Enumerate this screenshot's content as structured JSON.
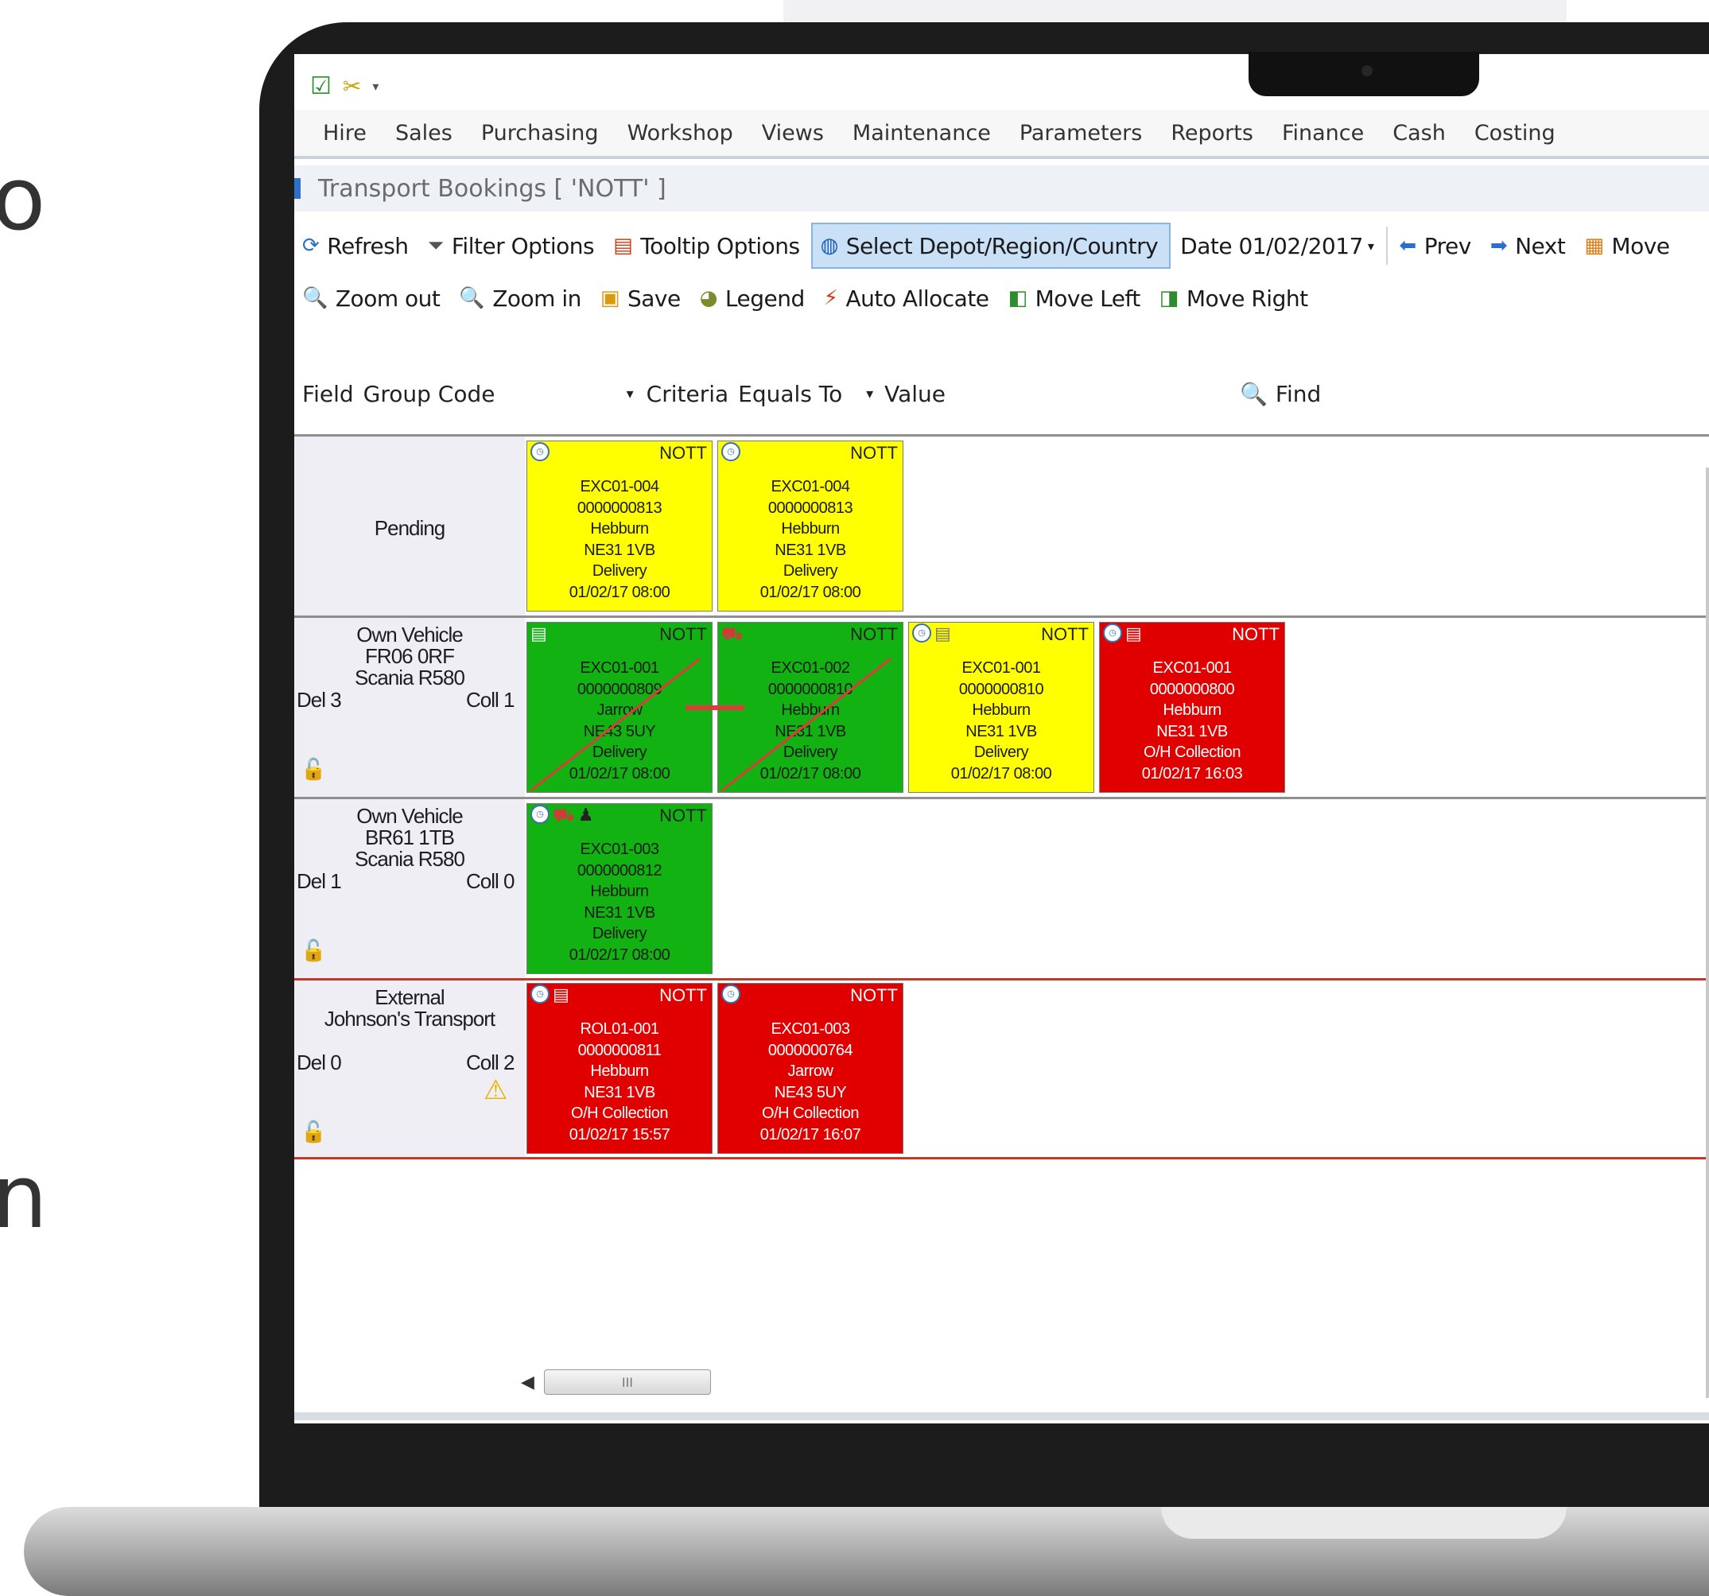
{
  "side_text": {
    "top": "o",
    "bottom": "n"
  },
  "app": {
    "qat_icons": [
      "save-check-icon",
      "tools-icon",
      "dropdown-caret-icon"
    ],
    "menu": [
      "Hire",
      "Sales",
      "Purchasing",
      "Workshop",
      "Views",
      "Maintenance",
      "Parameters",
      "Reports",
      "Finance",
      "Cash",
      "Costing"
    ],
    "window_title": "Transport Bookings [ 'NOTT' ]",
    "toolbar1": {
      "refresh": "Refresh",
      "filter": "Filter Options",
      "tooltip": "Tooltip Options",
      "select_depot": "Select Depot/Region/Country",
      "date": "Date 01/02/2017",
      "prev": "Prev",
      "next": "Next",
      "move": "Move"
    },
    "toolbar2": {
      "zoom_out": "Zoom out",
      "zoom_in": "Zoom in",
      "save": "Save",
      "legend": "Legend",
      "auto_allocate": "Auto Allocate",
      "move_left": "Move Left",
      "move_right": "Move Right"
    },
    "search": {
      "field_label": "Field",
      "field_value": "Group Code",
      "criteria_label": "Criteria",
      "criteria_value": "Equals To",
      "value_label": "Value",
      "value": "",
      "find": "Find"
    }
  },
  "rows": [
    {
      "label_lines": [
        "Pending"
      ],
      "cards": [
        {
          "depot": "NOTT",
          "color": "yellow",
          "lines": [
            "EXC01-004",
            "0000000813",
            "Hebburn",
            "NE31 1VB",
            "Delivery",
            "01/02/17 08:00"
          ]
        },
        {
          "depot": "NOTT",
          "color": "yellow",
          "lines": [
            "EXC01-004",
            "0000000813",
            "Hebburn",
            "NE31 1VB",
            "Delivery",
            "01/02/17 08:00"
          ]
        }
      ]
    },
    {
      "label_lines": [
        "Own Vehicle",
        "FR06 0RF",
        "Scania R580"
      ],
      "del": "Del 3",
      "coll": "Coll 1",
      "cards": [
        {
          "depot": "NOTT",
          "color": "green",
          "lines": [
            "EXC01-001",
            "0000000809",
            "Jarrow",
            "NE43 5UY",
            "Delivery",
            "01/02/17 08:00"
          ]
        },
        {
          "depot": "NOTT",
          "color": "green",
          "lines": [
            "EXC01-002",
            "0000000810",
            "Hebburn",
            "NE31 1VB",
            "Delivery",
            "01/02/17 08:00"
          ]
        },
        {
          "depot": "NOTT",
          "color": "yellow",
          "lines": [
            "EXC01-001",
            "0000000810",
            "Hebburn",
            "NE31 1VB",
            "Delivery",
            "01/02/17 08:00"
          ]
        },
        {
          "depot": "NOTT",
          "color": "red",
          "lines": [
            "EXC01-001",
            "0000000800",
            "Hebburn",
            "NE31 1VB",
            "O/H Collection",
            "01/02/17 16:03"
          ]
        }
      ]
    },
    {
      "label_lines": [
        "Own Vehicle",
        "BR61 1TB",
        "Scania R580"
      ],
      "del": "Del 1",
      "coll": "Coll 0",
      "cards": [
        {
          "depot": "NOTT",
          "color": "green",
          "lines": [
            "EXC01-003",
            "0000000812",
            "Hebburn",
            "NE31 1VB",
            "Delivery",
            "01/02/17 08:00"
          ]
        }
      ]
    },
    {
      "label_lines": [
        "External",
        "Johnson's Transport"
      ],
      "del": "Del 0",
      "coll": "Coll 2",
      "cards": [
        {
          "depot": "NOTT",
          "color": "red",
          "lines": [
            "ROL01-001",
            "0000000811",
            "Hebburn",
            "NE31 1VB",
            "O/H Collection",
            "01/02/17 15:57"
          ]
        },
        {
          "depot": "NOTT",
          "color": "red",
          "lines": [
            "EXC01-003",
            "0000000764",
            "Jarrow",
            "NE43 5UY",
            "O/H Collection",
            "01/02/17 16:07"
          ]
        }
      ]
    }
  ],
  "scrollbar": {
    "thumb_grip": "III"
  },
  "colors": {
    "yellow": "#ffff00",
    "green": "#11b211",
    "red": "#e00000",
    "active_button": "#c9e0f7"
  }
}
